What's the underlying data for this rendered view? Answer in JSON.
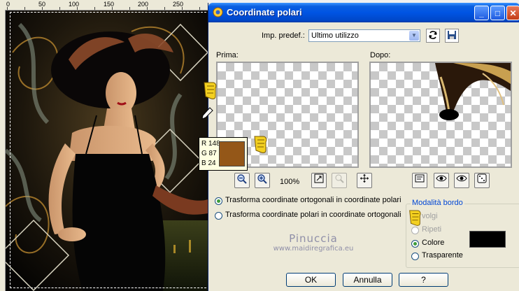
{
  "ruler": {
    "labels": [
      "0",
      "50",
      "100",
      "150",
      "200",
      "250"
    ]
  },
  "dialog": {
    "title": "Coordinate polari",
    "preset_label": "Imp. predef.:",
    "preset_value": "Ultimo utilizzo",
    "before_label": "Prima:",
    "after_label": "Dopo:",
    "zoom": "100%",
    "mode_options": [
      {
        "label": "Trasforma coordinate ortogonali in coordinate polari",
        "selected": true
      },
      {
        "label": "Trasforma coordinate polari in coordinate ortogonali",
        "selected": false
      }
    ],
    "border_group": {
      "title": "Modalità bordo",
      "options": [
        {
          "label": "Avvolgi",
          "shown_text": "volgi",
          "selected": false,
          "disabled": true
        },
        {
          "label": "Ripeti",
          "shown_text": "Ripeti",
          "selected": false,
          "disabled": true
        },
        {
          "label": "Colore",
          "shown_text": "Colore",
          "selected": true,
          "disabled": false
        },
        {
          "label": "Trasparente",
          "shown_text": "Trasparente",
          "selected": false,
          "disabled": false
        }
      ],
      "color": "#000000"
    },
    "buttons": {
      "ok": "OK",
      "cancel": "Annulla",
      "help": "?"
    }
  },
  "color_tooltip": {
    "r": "R 148",
    "g": "G 87",
    "b": "B 24",
    "swatch": "#945718"
  },
  "watermark": {
    "name": "Pinuccia",
    "url": "www.maidiregrafica.eu"
  },
  "colors": {
    "titlebar": "#0054e3",
    "dialog_bg": "#ece9d8",
    "radio_dot": "#3e9c3a"
  },
  "icons": [
    "save-preset-icon",
    "reset-preset-icon",
    "zoom-in-icon",
    "zoom-out-icon",
    "fit-icon",
    "pan-icon",
    "pointer-hand-icon",
    "eyedropper-icon"
  ]
}
